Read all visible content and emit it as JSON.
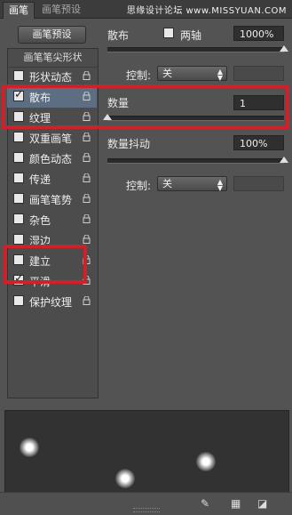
{
  "tabs": [
    {
      "label": "画笔",
      "active": true
    },
    {
      "label": "画笔预设",
      "active": false
    }
  ],
  "watermark": "思缘设计论坛 www.MISSYUAN.COM",
  "preset_button": "画笔预设",
  "list": {
    "header": "画笔笔尖形状",
    "items": [
      {
        "label": "形状动态",
        "checked": false,
        "selected": false
      },
      {
        "label": "散布",
        "checked": true,
        "selected": true
      },
      {
        "label": "纹理",
        "checked": false,
        "selected": false
      },
      {
        "label": "双重画笔",
        "checked": false,
        "selected": false
      },
      {
        "label": "颜色动态",
        "checked": false,
        "selected": false
      },
      {
        "label": "传递",
        "checked": false,
        "selected": false
      },
      {
        "label": "画笔笔势",
        "checked": false,
        "selected": false
      },
      {
        "label": "杂色",
        "checked": false,
        "selected": false
      },
      {
        "label": "湿边",
        "checked": false,
        "selected": false
      },
      {
        "label": "建立",
        "checked": false,
        "selected": false
      },
      {
        "label": "平滑",
        "checked": true,
        "selected": false
      },
      {
        "label": "保护纹理",
        "checked": false,
        "selected": false
      }
    ]
  },
  "scatter": {
    "label": "散布",
    "both_axes_label": "两轴",
    "both_axes_checked": false,
    "value": "1000%",
    "slider_level_percent": 100,
    "control_label": "控制:",
    "control_value": "关"
  },
  "count": {
    "label": "数量",
    "value": "1",
    "slider_level_percent": 0
  },
  "count_jitter": {
    "label": "数量抖动",
    "value": "100%",
    "slider_level_percent": 100,
    "control_label": "控制:",
    "control_value": "关"
  },
  "highlight_color": "#d0202a",
  "bottom_icons": [
    "brush-toggle-icon",
    "grid-icon",
    "new-preset-icon"
  ]
}
